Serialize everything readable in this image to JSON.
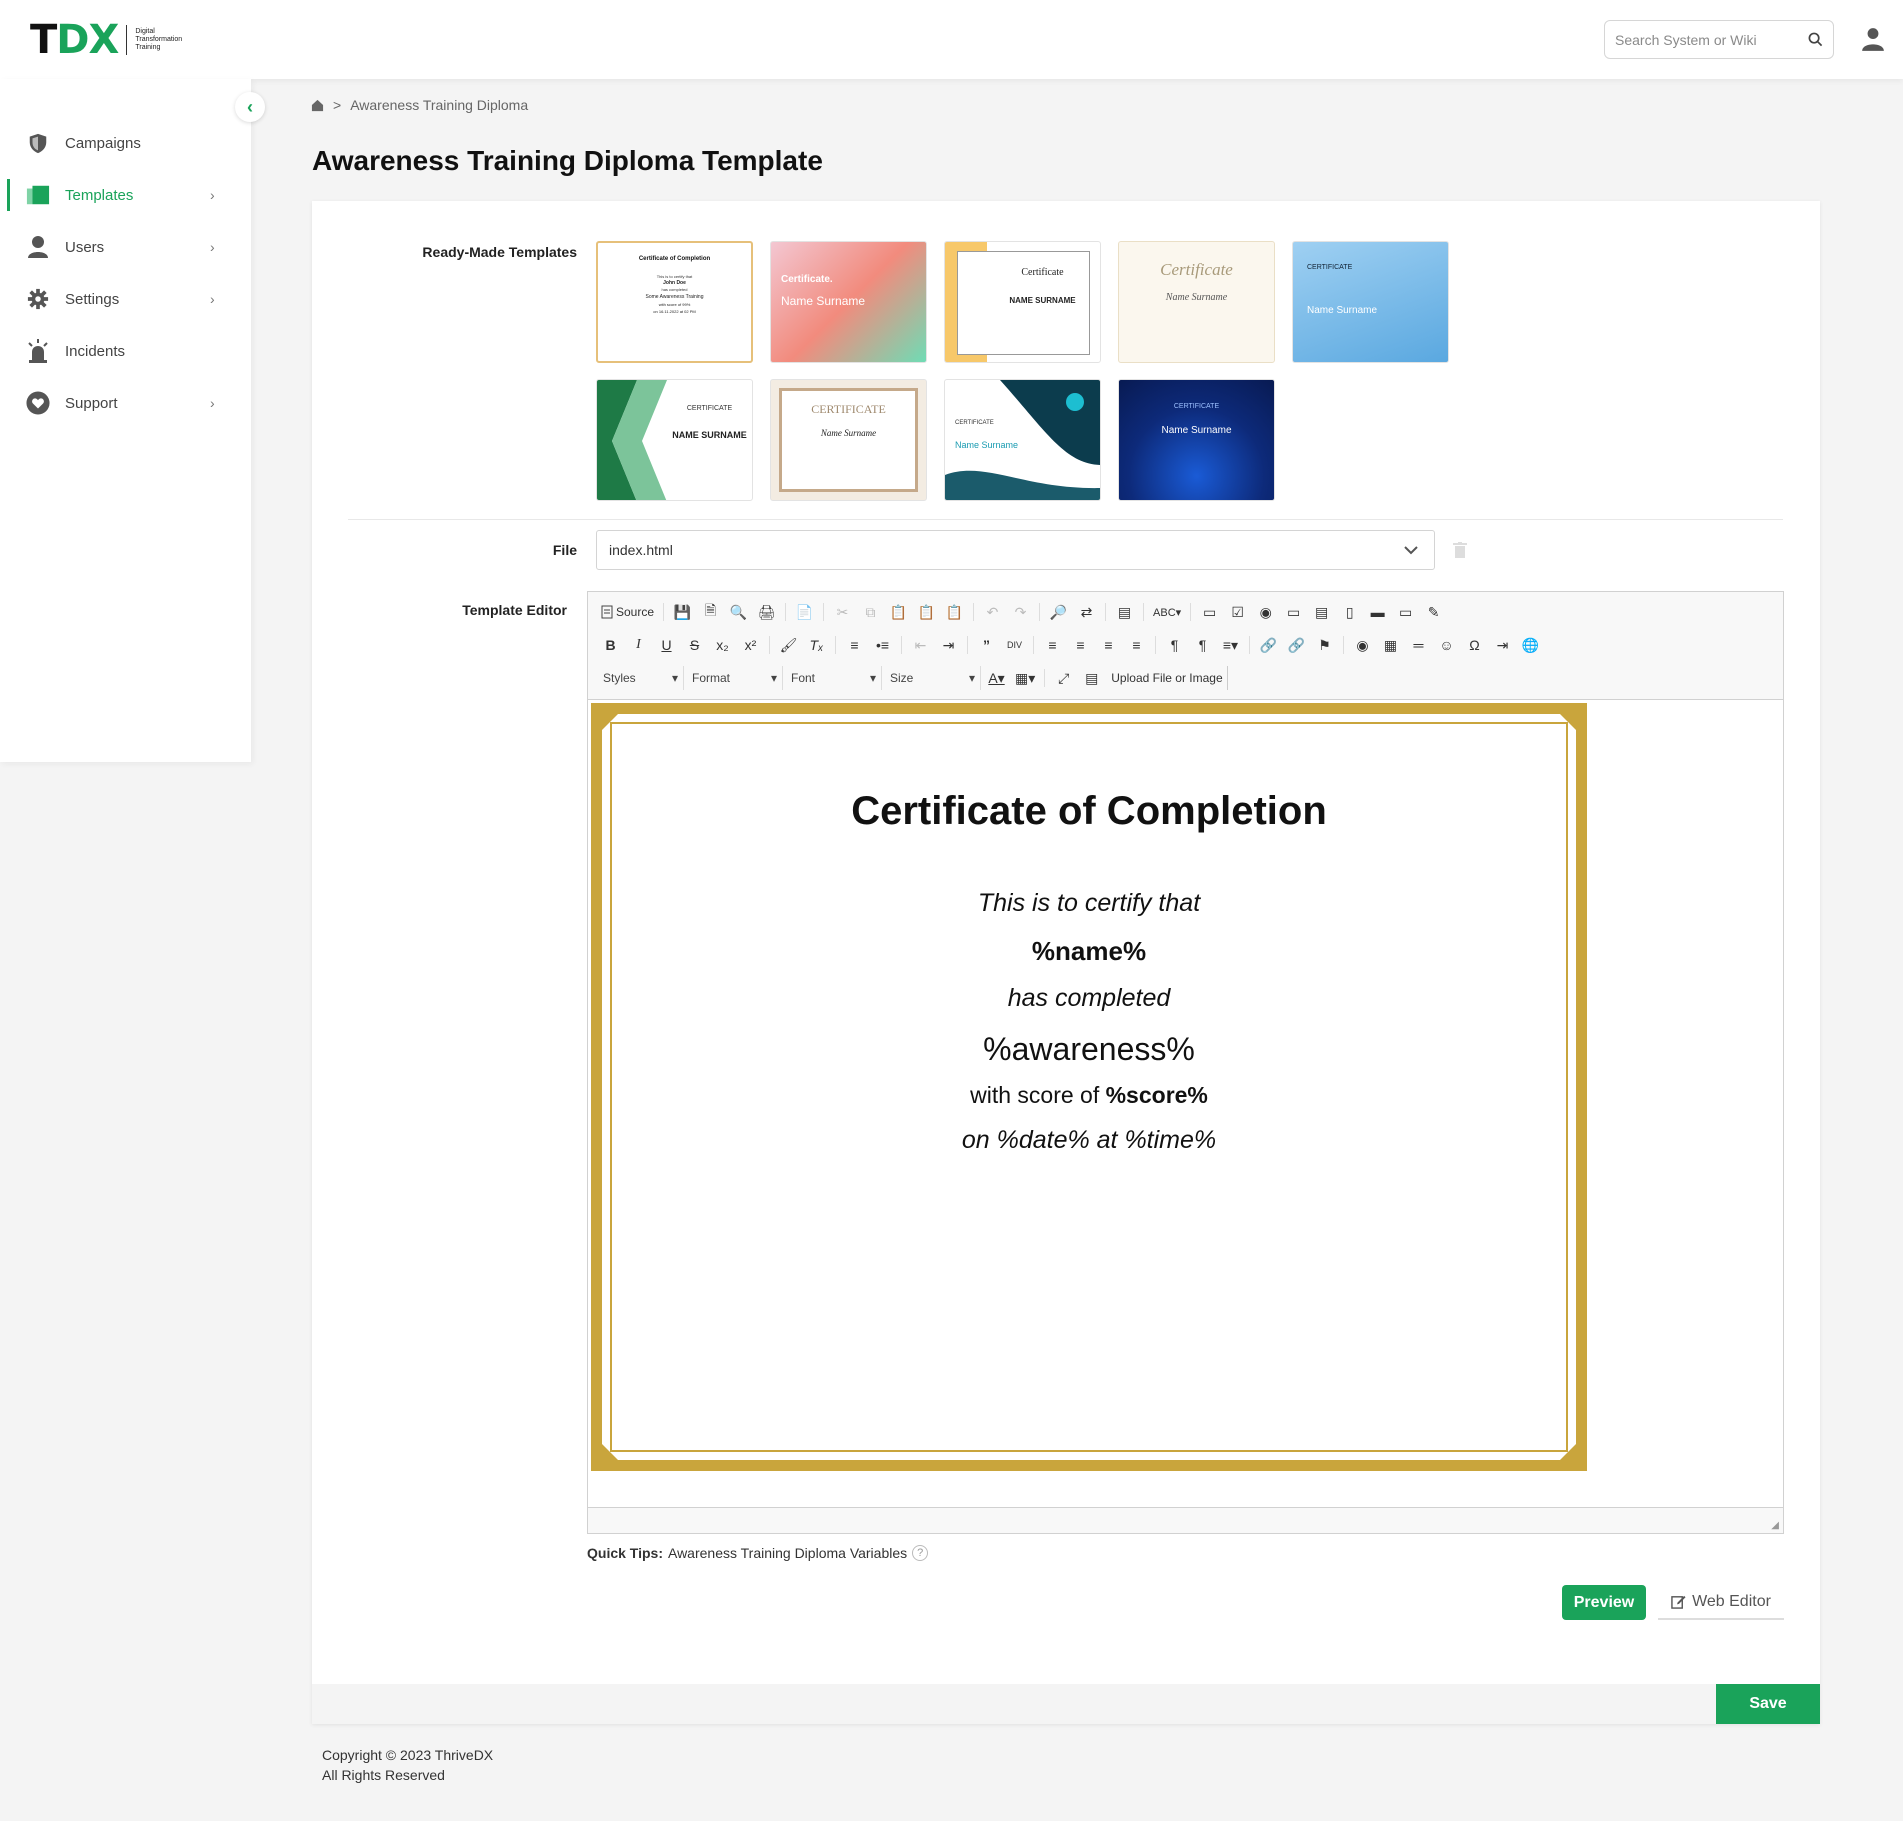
{
  "brand": {
    "logo_text_a": "T",
    "logo_text_b": "DX",
    "tagline_1": "Digital",
    "tagline_2": "Transformation",
    "tagline_3": "Training"
  },
  "header": {
    "search_placeholder": "Search System or Wiki"
  },
  "sidebar": {
    "items": [
      {
        "label": "Campaigns",
        "icon": "shield-icon",
        "has_submenu": false,
        "active": false
      },
      {
        "label": "Templates",
        "icon": "templates-icon",
        "has_submenu": true,
        "active": true
      },
      {
        "label": "Users",
        "icon": "users-icon",
        "has_submenu": true,
        "active": false
      },
      {
        "label": "Settings",
        "icon": "gear-icon",
        "has_submenu": true,
        "active": false
      },
      {
        "label": "Incidents",
        "icon": "alarm-icon",
        "has_submenu": false,
        "active": false
      },
      {
        "label": "Support",
        "icon": "heart-icon",
        "has_submenu": true,
        "active": false
      }
    ]
  },
  "breadcrumb": {
    "separator": ">",
    "current": "Awareness Training Diploma"
  },
  "page_title": "Awareness Training Diploma Template",
  "form": {
    "ready_made_label": "Ready-Made Templates",
    "file_label": "File",
    "file_value": "index.html",
    "editor_label": "Template Editor"
  },
  "templates": [
    {
      "title": "Certificate of Completion",
      "name": "John Doe",
      "selected": true
    },
    {
      "title": "Certificate.",
      "name": "Name Surname",
      "selected": false
    },
    {
      "title": "Certificate",
      "name": "NAME SURNAME",
      "selected": false
    },
    {
      "title": "Certificate",
      "name": "Name Surname",
      "selected": false
    },
    {
      "title": "CERTIFICATE",
      "name": "Name Surname",
      "selected": false
    },
    {
      "title": "CERTIFICATE",
      "name": "NAME SURNAME",
      "selected": false
    },
    {
      "title": "CERTIFICATE",
      "name": "Name Surname",
      "selected": false
    },
    {
      "title": "CERTIFICATE",
      "name": "Name Surname",
      "selected": false
    },
    {
      "title": "CERTIFICATE",
      "name": "Name Surname",
      "selected": false
    }
  ],
  "toolbar": {
    "source_label": "Source",
    "styles_label": "Styles",
    "format_label": "Format",
    "font_label": "Font",
    "size_label": "Size",
    "upload_label": "Upload File or Image"
  },
  "certificate": {
    "title": "Certificate of Completion",
    "line1": "This is to certify that",
    "name_var": "%name%",
    "line3": "has completed",
    "awareness_var": "%awareness%",
    "score_prefix": "with score of",
    "score_var": "%score%",
    "date_line": "on %date% at %time%"
  },
  "quick_tips": {
    "label": "Quick Tips:",
    "text": "Awareness Training Diploma Variables",
    "help": "?"
  },
  "actions": {
    "preview": "Preview",
    "web_editor": "Web Editor",
    "save": "Save"
  },
  "footer": {
    "copyright": "Copyright © 2023 ThriveDX",
    "rights": "All Rights Reserved"
  },
  "colors": {
    "accent": "#1aa35a",
    "gold": "#c9a53c"
  }
}
